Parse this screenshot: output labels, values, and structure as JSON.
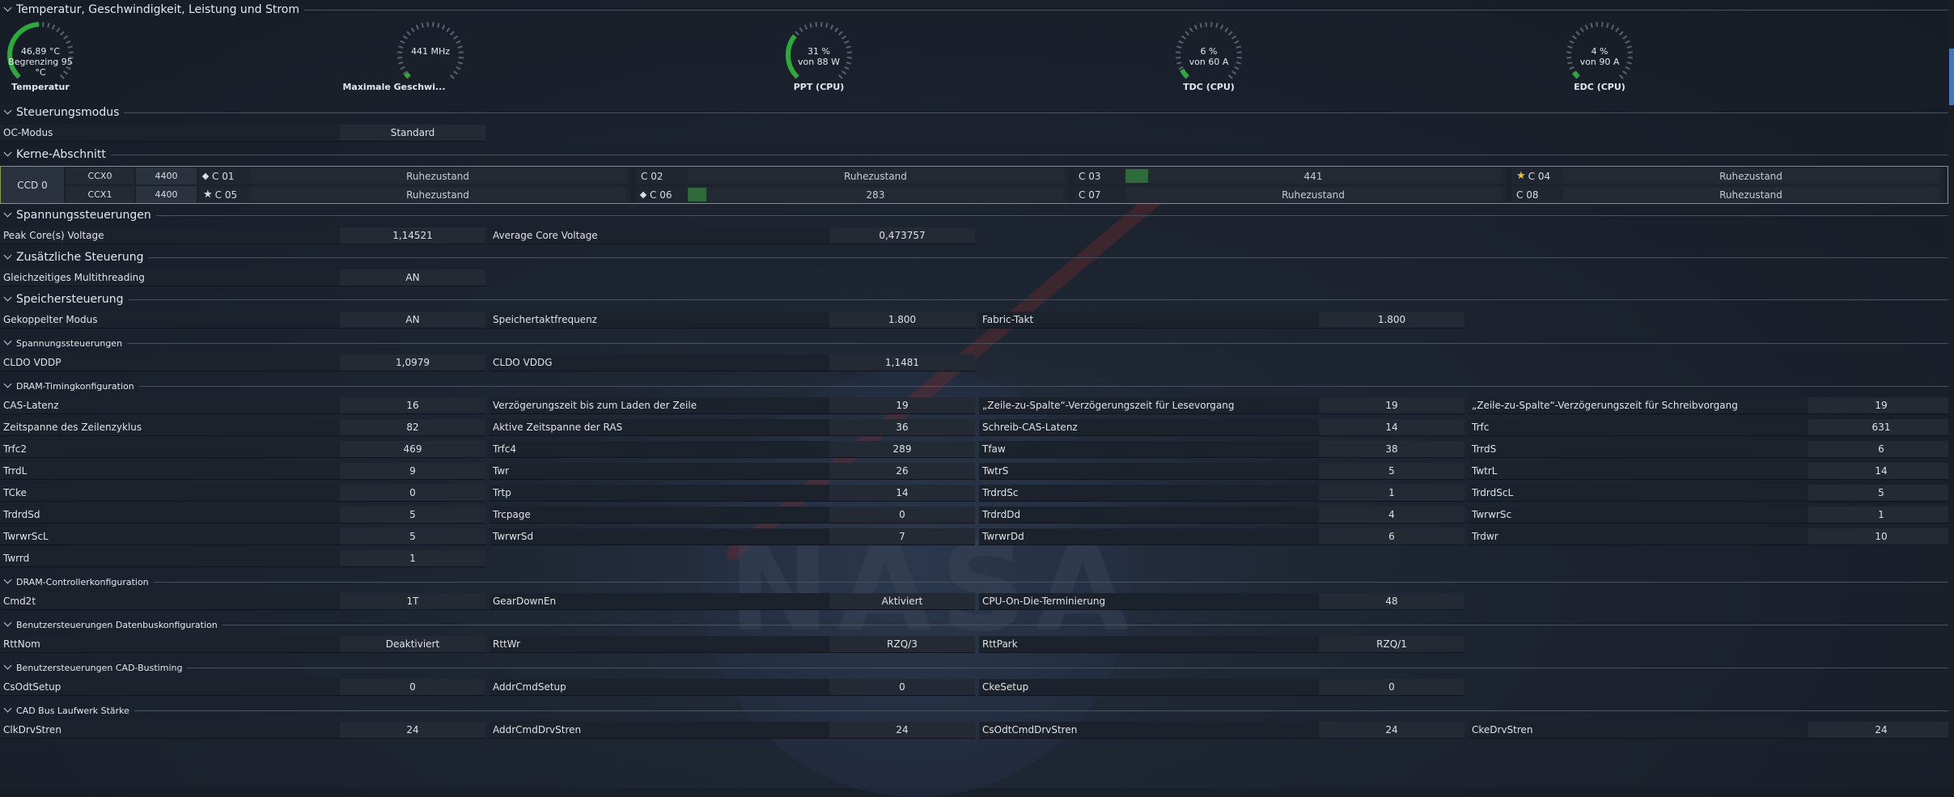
{
  "sections": {
    "tgls": "Temperatur, Geschwindigkeit, Leistung und Strom",
    "steuerungsmodus": "Steuerungsmodus",
    "kerne": "Kerne-Abschnitt",
    "spannung": "Spannungssteuerungen",
    "zusatz": "Zusätzliche Steuerung",
    "speicher": "Speichersteuerung",
    "spannung2": "Spannungssteuerungen",
    "dram_timing": "DRAM-Timingkonfiguration",
    "dram_ctrl": "DRAM-Controllerkonfiguration",
    "datenbus": "Benutzersteuerungen Datenbuskonfiguration",
    "cad": "Benutzersteuerungen CAD-Bustiming",
    "cadbus": "CAD Bus Laufwerk Stärke"
  },
  "gauges": [
    {
      "v1": "46,89 °C",
      "v2": "Begrenzing  95 °C",
      "name": "Temperatur",
      "fill": 0.49
    },
    {
      "v1": "441  MHz",
      "v2": "",
      "name": "Maximale Geschwi...",
      "fill": 0.03
    },
    {
      "v1": "31 %",
      "v2": "von  88 W",
      "name": "PPT (CPU)",
      "fill": 0.31
    },
    {
      "v1": "6 %",
      "v2": "von  60 A",
      "name": "TDC (CPU)",
      "fill": 0.06
    },
    {
      "v1": "4 %",
      "v2": "von  90 A",
      "name": "EDC (CPU)",
      "fill": 0.04
    }
  ],
  "oc": {
    "label": "OC-Modus",
    "value": "Standard"
  },
  "cores": {
    "ccd": "CCD 0",
    "ccx0": "CCX0",
    "ccx0_freq": "4400",
    "ccx1": "CCX1",
    "ccx1_freq": "4400",
    "row1": [
      {
        "name": "C 01",
        "status": "Ruhezustand",
        "mark": "dot",
        "load": 0
      },
      {
        "name": "C 02",
        "status": "Ruhezustand",
        "mark": "",
        "load": 0
      },
      {
        "name": "C 03",
        "status": "441",
        "mark": "",
        "load": 0.06
      },
      {
        "name": "C 04",
        "status": "Ruhezustand",
        "mark": "star-gold",
        "load": 0
      }
    ],
    "row2": [
      {
        "name": "C 05",
        "status": "Ruhezustand",
        "mark": "star-white",
        "load": 0
      },
      {
        "name": "C 06",
        "status": "283",
        "mark": "dot",
        "load": 0.05
      },
      {
        "name": "C 07",
        "status": "Ruhezustand",
        "mark": "",
        "load": 0
      },
      {
        "name": "C 08",
        "status": "Ruhezustand",
        "mark": "",
        "load": 0
      }
    ]
  },
  "voltage": [
    {
      "label": "Peak Core(s) Voltage",
      "value": "1,14521"
    },
    {
      "label": "Average Core Voltage",
      "value": "0,473757"
    }
  ],
  "smt": {
    "label": "Gleichzeitiges Multithreading",
    "value": "AN"
  },
  "memory": [
    {
      "label": "Gekoppelter Modus",
      "value": "AN"
    },
    {
      "label": "Speichertaktfrequenz",
      "value": "1.800"
    },
    {
      "label": "Fabric-Takt",
      "value": "1.800"
    }
  ],
  "cldo": [
    {
      "label": "CLDO VDDP",
      "value": "1,0979"
    },
    {
      "label": "CLDO VDDG",
      "value": "1,1481"
    }
  ],
  "timing": [
    [
      {
        "label": "CAS-Latenz",
        "value": "16"
      },
      {
        "label": "Verzögerungszeit bis zum Laden der Zeile",
        "value": "19"
      },
      {
        "label": "„Zeile-zu-Spalte“-Verzögerungszeit für Lesevorgang",
        "value": "19"
      },
      {
        "label": "„Zeile-zu-Spalte“-Verzögerungszeit für Schreibvorgang",
        "value": "19"
      }
    ],
    [
      {
        "label": "Zeitspanne des Zeilenzyklus",
        "value": "82"
      },
      {
        "label": "Aktive Zeitspanne der RAS",
        "value": "36"
      },
      {
        "label": "Schreib-CAS-Latenz",
        "value": "14"
      },
      {
        "label": "Trfc",
        "value": "631"
      }
    ],
    [
      {
        "label": "Trfc2",
        "value": "469"
      },
      {
        "label": "Trfc4",
        "value": "289"
      },
      {
        "label": "Tfaw",
        "value": "38"
      },
      {
        "label": "TrrdS",
        "value": "6"
      }
    ],
    [
      {
        "label": "TrrdL",
        "value": "9"
      },
      {
        "label": "Twr",
        "value": "26"
      },
      {
        "label": "TwtrS",
        "value": "5"
      },
      {
        "label": "TwtrL",
        "value": "14"
      }
    ],
    [
      {
        "label": "TCke",
        "value": "0"
      },
      {
        "label": "Trtp",
        "value": "14"
      },
      {
        "label": "TrdrdSc",
        "value": "1"
      },
      {
        "label": "TrdrdScL",
        "value": "5"
      }
    ],
    [
      {
        "label": "TrdrdSd",
        "value": "5"
      },
      {
        "label": "Trcpage",
        "value": "0"
      },
      {
        "label": "TrdrdDd",
        "value": "4"
      },
      {
        "label": "TwrwrSc",
        "value": "1"
      }
    ],
    [
      {
        "label": "TwrwrScL",
        "value": "5"
      },
      {
        "label": "TwrwrSd",
        "value": "7"
      },
      {
        "label": "TwrwrDd",
        "value": "6"
      },
      {
        "label": "Trdwr",
        "value": "10"
      }
    ],
    [
      {
        "label": "Twrrd",
        "value": "1"
      }
    ]
  ],
  "ctrl": [
    {
      "label": "Cmd2t",
      "value": "1T"
    },
    {
      "label": "GearDownEn",
      "value": "Aktiviert"
    },
    {
      "label": "CPU-On-Die-Terminierung",
      "value": "48"
    }
  ],
  "bus": [
    {
      "label": "RttNom",
      "value": "Deaktiviert"
    },
    {
      "label": "RttWr",
      "value": "RZQ/3"
    },
    {
      "label": "RttPark",
      "value": "RZQ/1"
    }
  ],
  "cadtiming": [
    {
      "label": "CsOdtSetup",
      "value": "0"
    },
    {
      "label": "AddrCmdSetup",
      "value": "0"
    },
    {
      "label": "CkeSetup",
      "value": "0"
    }
  ],
  "cadstrength": [
    {
      "label": "ClkDrvStren",
      "value": "24"
    },
    {
      "label": "AddrCmdDrvStren",
      "value": "24"
    },
    {
      "label": "CsOdtCmdDrvStren",
      "value": "24"
    },
    {
      "label": "CkeDrvStren",
      "value": "24"
    }
  ],
  "colors": {
    "accent": "#2fa83c",
    "highlight_border": "#8a9a55"
  },
  "background_text": "NASA"
}
